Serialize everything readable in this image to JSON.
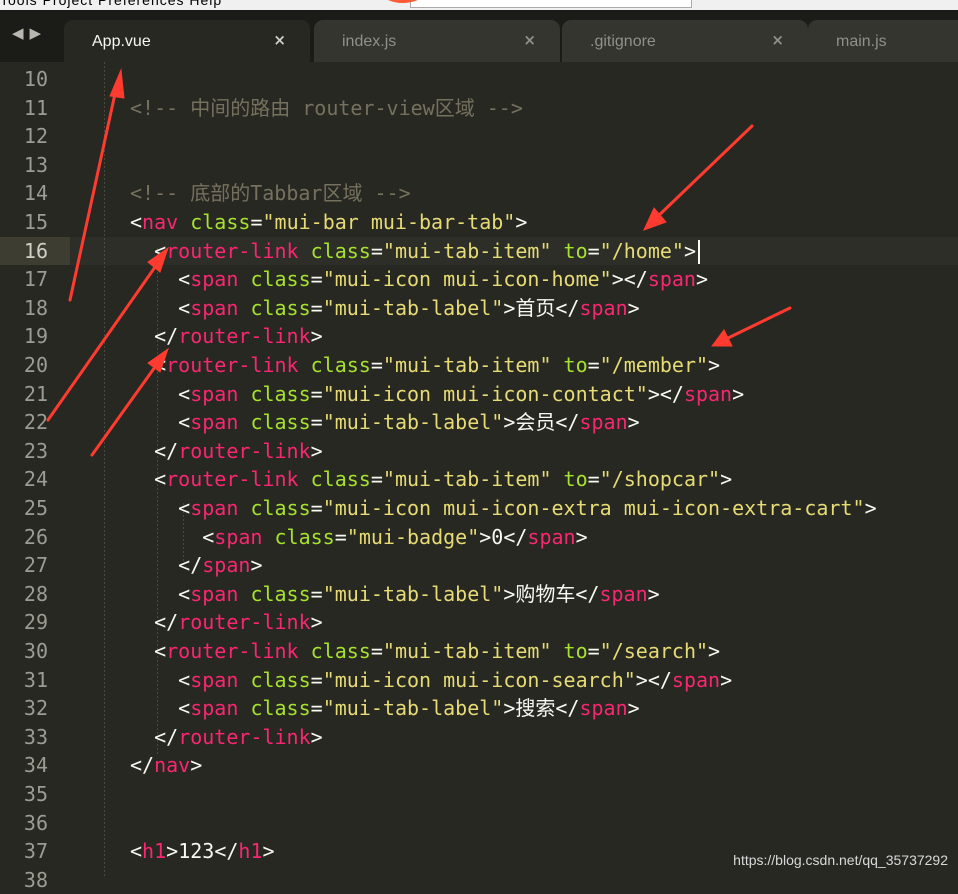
{
  "menu": {
    "text": "Tools  Project  Preferences  Help"
  },
  "nav": {
    "back": "◀",
    "forward": "▶"
  },
  "tabs": [
    {
      "label": "App.vue",
      "close": "×",
      "active": true
    },
    {
      "label": "index.js",
      "close": "×",
      "active": false
    },
    {
      "label": ".gitignore",
      "close": "×",
      "active": false
    },
    {
      "label": "main.js",
      "close": "",
      "active": false
    }
  ],
  "editor": {
    "current_line": 16,
    "lines": [
      {
        "n": "10",
        "tokens": []
      },
      {
        "n": "11",
        "tokens": [
          [
            "comment",
            "<!-- 中间的路由 router-view区域 -->"
          ]
        ]
      },
      {
        "n": "12",
        "tokens": []
      },
      {
        "n": "13",
        "tokens": []
      },
      {
        "n": "14",
        "tokens": [
          [
            "comment",
            "<!-- 底部的Tabbar区域 -->"
          ]
        ]
      },
      {
        "n": "15",
        "tokens": [
          [
            "punc",
            "<"
          ],
          [
            "tag",
            "nav"
          ],
          [
            "text",
            " "
          ],
          [
            "attr",
            "class"
          ],
          [
            "punc",
            "="
          ],
          [
            "str",
            "\"mui-bar mui-bar-tab\""
          ],
          [
            "punc",
            ">"
          ]
        ]
      },
      {
        "n": "16",
        "tokens": [
          [
            "text",
            "  "
          ],
          [
            "punc",
            "<"
          ],
          [
            "tag",
            "router-link"
          ],
          [
            "text",
            " "
          ],
          [
            "attr",
            "class"
          ],
          [
            "punc",
            "="
          ],
          [
            "str",
            "\"mui-tab-item\""
          ],
          [
            "text",
            " "
          ],
          [
            "attr",
            "to"
          ],
          [
            "punc",
            "="
          ],
          [
            "str",
            "\"/home\""
          ],
          [
            "punc",
            ">"
          ]
        ]
      },
      {
        "n": "17",
        "tokens": [
          [
            "text",
            "    "
          ],
          [
            "punc",
            "<"
          ],
          [
            "tag",
            "span"
          ],
          [
            "text",
            " "
          ],
          [
            "attr",
            "class"
          ],
          [
            "punc",
            "="
          ],
          [
            "str",
            "\"mui-icon mui-icon-home\""
          ],
          [
            "punc",
            "></"
          ],
          [
            "tag",
            "span"
          ],
          [
            "punc",
            ">"
          ]
        ]
      },
      {
        "n": "18",
        "tokens": [
          [
            "text",
            "    "
          ],
          [
            "punc",
            "<"
          ],
          [
            "tag",
            "span"
          ],
          [
            "text",
            " "
          ],
          [
            "attr",
            "class"
          ],
          [
            "punc",
            "="
          ],
          [
            "str",
            "\"mui-tab-label\""
          ],
          [
            "punc",
            ">"
          ],
          [
            "text",
            "首页"
          ],
          [
            "punc",
            "</"
          ],
          [
            "tag",
            "span"
          ],
          [
            "punc",
            ">"
          ]
        ]
      },
      {
        "n": "19",
        "tokens": [
          [
            "text",
            "  "
          ],
          [
            "punc",
            "</"
          ],
          [
            "tag",
            "router-link"
          ],
          [
            "punc",
            ">"
          ]
        ]
      },
      {
        "n": "20",
        "tokens": [
          [
            "text",
            "  "
          ],
          [
            "punc",
            "<"
          ],
          [
            "tag",
            "router-link"
          ],
          [
            "text",
            " "
          ],
          [
            "attr",
            "class"
          ],
          [
            "punc",
            "="
          ],
          [
            "str",
            "\"mui-tab-item\""
          ],
          [
            "text",
            " "
          ],
          [
            "attr",
            "to"
          ],
          [
            "punc",
            "="
          ],
          [
            "str",
            "\"/member\""
          ],
          [
            "punc",
            ">"
          ]
        ]
      },
      {
        "n": "21",
        "tokens": [
          [
            "text",
            "    "
          ],
          [
            "punc",
            "<"
          ],
          [
            "tag",
            "span"
          ],
          [
            "text",
            " "
          ],
          [
            "attr",
            "class"
          ],
          [
            "punc",
            "="
          ],
          [
            "str",
            "\"mui-icon mui-icon-contact\""
          ],
          [
            "punc",
            "></"
          ],
          [
            "tag",
            "span"
          ],
          [
            "punc",
            ">"
          ]
        ]
      },
      {
        "n": "22",
        "tokens": [
          [
            "text",
            "    "
          ],
          [
            "punc",
            "<"
          ],
          [
            "tag",
            "span"
          ],
          [
            "text",
            " "
          ],
          [
            "attr",
            "class"
          ],
          [
            "punc",
            "="
          ],
          [
            "str",
            "\"mui-tab-label\""
          ],
          [
            "punc",
            ">"
          ],
          [
            "text",
            "会员"
          ],
          [
            "punc",
            "</"
          ],
          [
            "tag",
            "span"
          ],
          [
            "punc",
            ">"
          ]
        ]
      },
      {
        "n": "23",
        "tokens": [
          [
            "text",
            "  "
          ],
          [
            "punc",
            "</"
          ],
          [
            "tag",
            "router-link"
          ],
          [
            "punc",
            ">"
          ]
        ]
      },
      {
        "n": "24",
        "tokens": [
          [
            "text",
            "  "
          ],
          [
            "punc",
            "<"
          ],
          [
            "tag",
            "router-link"
          ],
          [
            "text",
            " "
          ],
          [
            "attr",
            "class"
          ],
          [
            "punc",
            "="
          ],
          [
            "str",
            "\"mui-tab-item\""
          ],
          [
            "text",
            " "
          ],
          [
            "attr",
            "to"
          ],
          [
            "punc",
            "="
          ],
          [
            "str",
            "\"/shopcar\""
          ],
          [
            "punc",
            ">"
          ]
        ]
      },
      {
        "n": "25",
        "tokens": [
          [
            "text",
            "    "
          ],
          [
            "punc",
            "<"
          ],
          [
            "tag",
            "span"
          ],
          [
            "text",
            " "
          ],
          [
            "attr",
            "class"
          ],
          [
            "punc",
            "="
          ],
          [
            "str",
            "\"mui-icon mui-icon-extra mui-icon-extra-cart\""
          ],
          [
            "punc",
            ">"
          ]
        ]
      },
      {
        "n": "26",
        "tokens": [
          [
            "text",
            "      "
          ],
          [
            "punc",
            "<"
          ],
          [
            "tag",
            "span"
          ],
          [
            "text",
            " "
          ],
          [
            "attr",
            "class"
          ],
          [
            "punc",
            "="
          ],
          [
            "str",
            "\"mui-badge\""
          ],
          [
            "punc",
            ">"
          ],
          [
            "text",
            "0"
          ],
          [
            "punc",
            "</"
          ],
          [
            "tag",
            "span"
          ],
          [
            "punc",
            ">"
          ]
        ]
      },
      {
        "n": "27",
        "tokens": [
          [
            "text",
            "    "
          ],
          [
            "punc",
            "</"
          ],
          [
            "tag",
            "span"
          ],
          [
            "punc",
            ">"
          ]
        ]
      },
      {
        "n": "28",
        "tokens": [
          [
            "text",
            "    "
          ],
          [
            "punc",
            "<"
          ],
          [
            "tag",
            "span"
          ],
          [
            "text",
            " "
          ],
          [
            "attr",
            "class"
          ],
          [
            "punc",
            "="
          ],
          [
            "str",
            "\"mui-tab-label\""
          ],
          [
            "punc",
            ">"
          ],
          [
            "text",
            "购物车"
          ],
          [
            "punc",
            "</"
          ],
          [
            "tag",
            "span"
          ],
          [
            "punc",
            ">"
          ]
        ]
      },
      {
        "n": "29",
        "tokens": [
          [
            "text",
            "  "
          ],
          [
            "punc",
            "</"
          ],
          [
            "tag",
            "router-link"
          ],
          [
            "punc",
            ">"
          ]
        ]
      },
      {
        "n": "30",
        "tokens": [
          [
            "text",
            "  "
          ],
          [
            "punc",
            "<"
          ],
          [
            "tag",
            "router-link"
          ],
          [
            "text",
            " "
          ],
          [
            "attr",
            "class"
          ],
          [
            "punc",
            "="
          ],
          [
            "str",
            "\"mui-tab-item\""
          ],
          [
            "text",
            " "
          ],
          [
            "attr",
            "to"
          ],
          [
            "punc",
            "="
          ],
          [
            "str",
            "\"/search\""
          ],
          [
            "punc",
            ">"
          ]
        ]
      },
      {
        "n": "31",
        "tokens": [
          [
            "text",
            "    "
          ],
          [
            "punc",
            "<"
          ],
          [
            "tag",
            "span"
          ],
          [
            "text",
            " "
          ],
          [
            "attr",
            "class"
          ],
          [
            "punc",
            "="
          ],
          [
            "str",
            "\"mui-icon mui-icon-search\""
          ],
          [
            "punc",
            "></"
          ],
          [
            "tag",
            "span"
          ],
          [
            "punc",
            ">"
          ]
        ]
      },
      {
        "n": "32",
        "tokens": [
          [
            "text",
            "    "
          ],
          [
            "punc",
            "<"
          ],
          [
            "tag",
            "span"
          ],
          [
            "text",
            " "
          ],
          [
            "attr",
            "class"
          ],
          [
            "punc",
            "="
          ],
          [
            "str",
            "\"mui-tab-label\""
          ],
          [
            "punc",
            ">"
          ],
          [
            "text",
            "搜索"
          ],
          [
            "punc",
            "</"
          ],
          [
            "tag",
            "span"
          ],
          [
            "punc",
            ">"
          ]
        ]
      },
      {
        "n": "33",
        "tokens": [
          [
            "text",
            "  "
          ],
          [
            "punc",
            "</"
          ],
          [
            "tag",
            "router-link"
          ],
          [
            "punc",
            ">"
          ]
        ]
      },
      {
        "n": "34",
        "tokens": [
          [
            "punc",
            "</"
          ],
          [
            "tag",
            "nav"
          ],
          [
            "punc",
            ">"
          ]
        ]
      },
      {
        "n": "35",
        "tokens": []
      },
      {
        "n": "36",
        "tokens": []
      },
      {
        "n": "37",
        "tokens": [
          [
            "punc",
            "<"
          ],
          [
            "tag",
            "h1"
          ],
          [
            "punc",
            ">"
          ],
          [
            "text",
            "123"
          ],
          [
            "punc",
            "</"
          ],
          [
            "tag",
            "h1"
          ],
          [
            "punc",
            ">"
          ]
        ]
      },
      {
        "n": "38",
        "tokens": []
      }
    ]
  },
  "watermark": "https://blog.csdn.net/qq_35737292",
  "colors": {
    "background": "#272822",
    "comment": "#75715e",
    "tag": "#f92672",
    "attr": "#a6e22e",
    "string": "#e6db74",
    "text": "#f8f8f2",
    "annotation_arrow": "#ff3b30"
  }
}
